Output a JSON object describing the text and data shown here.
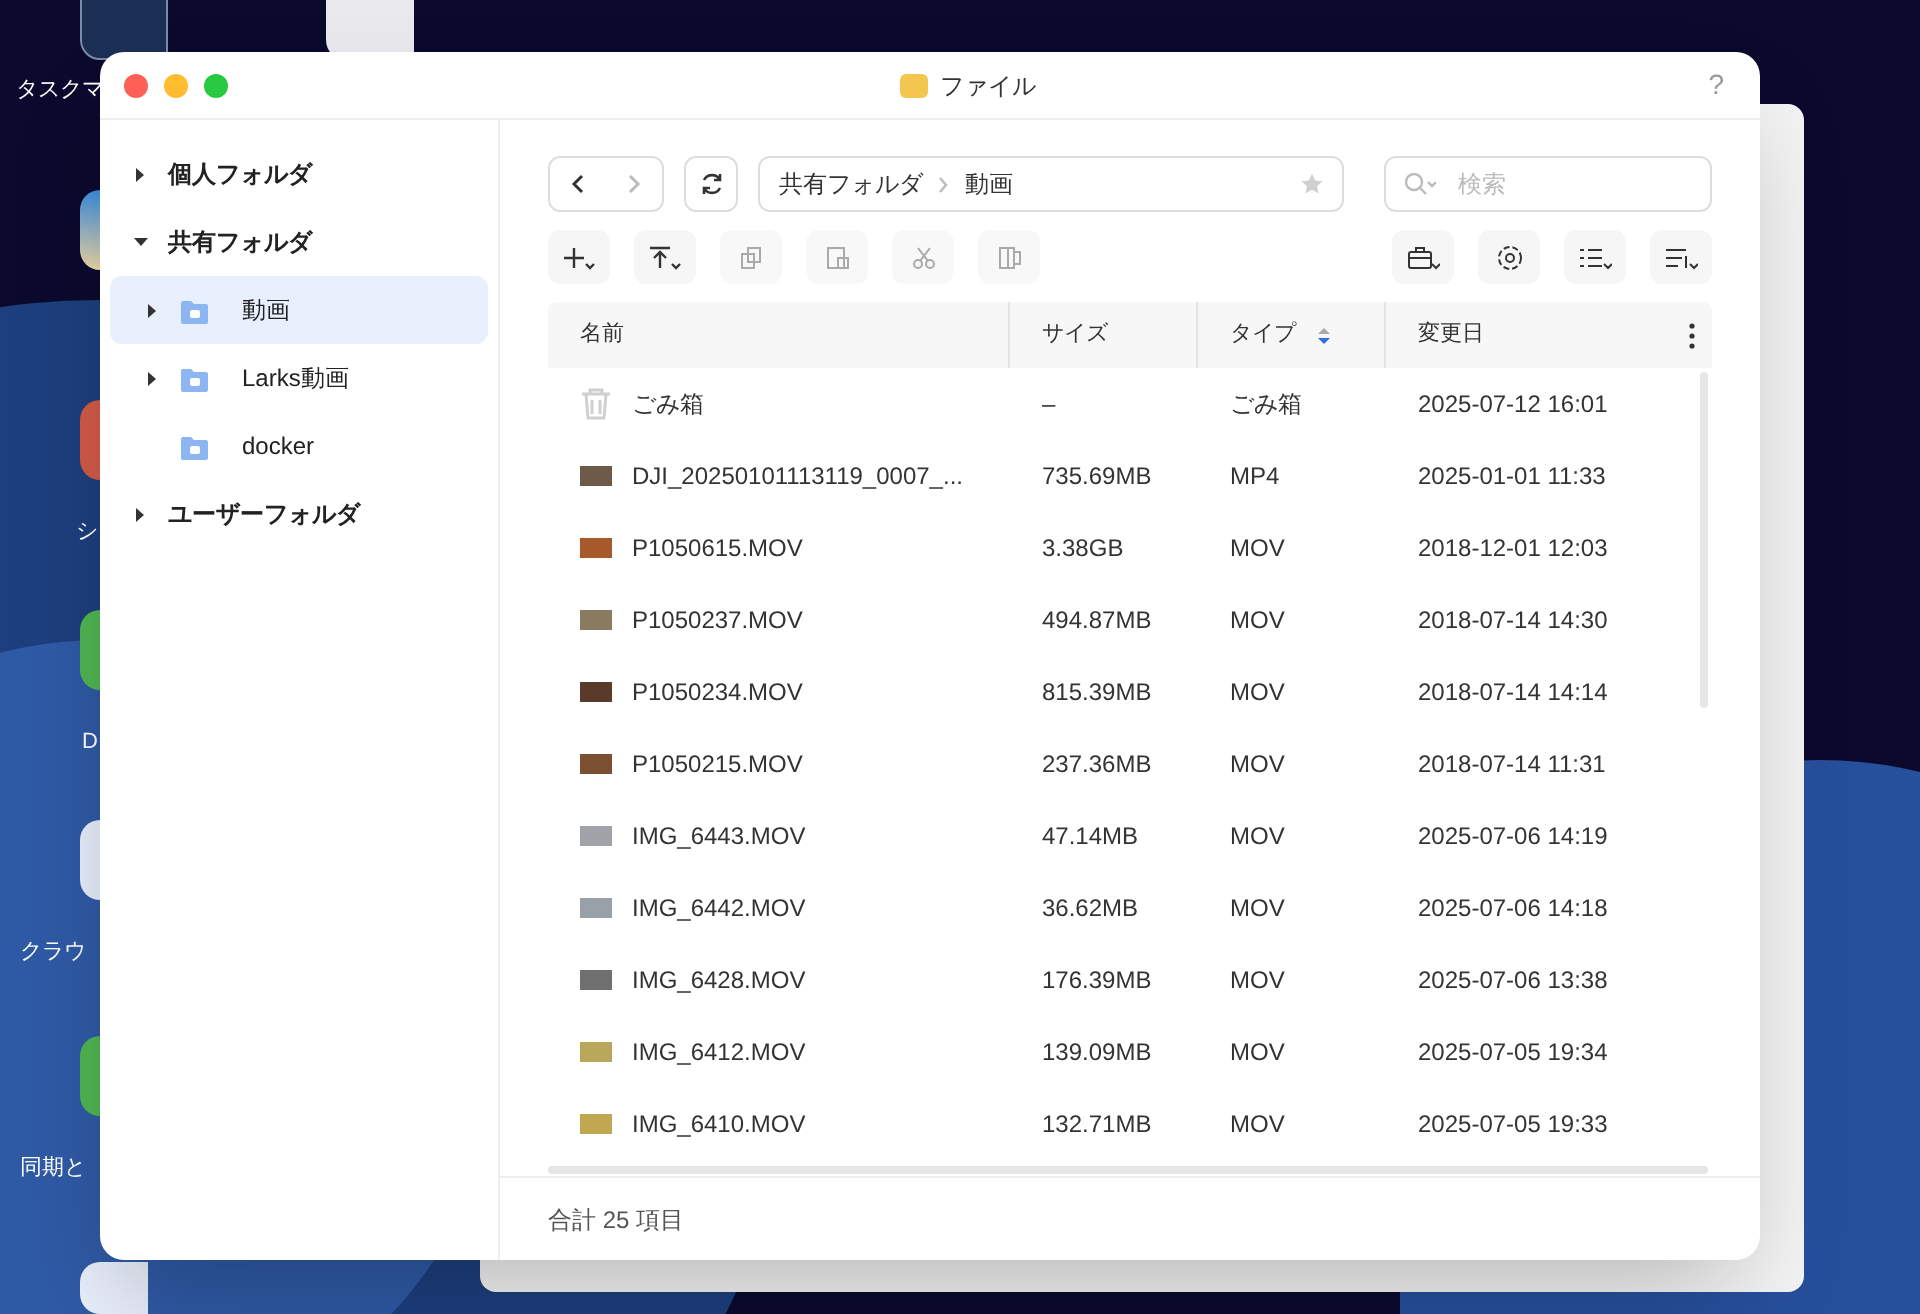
{
  "desktop": {
    "icons": [
      {
        "kind": "monitor",
        "label": "タスクマ"
      },
      {
        "kind": "browser"
      },
      {
        "kind": "photo"
      },
      {
        "kind": "red",
        "label": "シ"
      },
      {
        "kind": "green",
        "label": "D"
      },
      {
        "kind": "blue",
        "label": "クラウ"
      },
      {
        "kind": "green",
        "label": "同期と"
      },
      {
        "kind": "docker"
      }
    ]
  },
  "window": {
    "title": "ファイル",
    "help": "?"
  },
  "sidebar": {
    "items": [
      {
        "label": "個人フォルダ",
        "expanded": false,
        "selected": false
      },
      {
        "label": "共有フォルダ",
        "expanded": true,
        "selected": false,
        "children": [
          {
            "label": "動画",
            "has_children": true,
            "selected": true
          },
          {
            "label": "Larks動画",
            "has_children": true,
            "selected": false
          },
          {
            "label": "docker",
            "has_children": false,
            "selected": false
          }
        ]
      },
      {
        "label": "ユーザーフォルダ",
        "expanded": false,
        "selected": false
      }
    ]
  },
  "path_bar": {
    "breadcrumb": [
      "共有フォルダ",
      "動画"
    ],
    "favorite": false
  },
  "search": {
    "placeholder": "検索"
  },
  "table": {
    "columns": [
      {
        "label": "名前",
        "sorted": false
      },
      {
        "label": "サイズ",
        "sorted": false
      },
      {
        "label": "タイプ",
        "sorted": true
      },
      {
        "label": "変更日",
        "sorted": false
      }
    ],
    "rows": [
      {
        "kind": "trash",
        "name": "ごみ箱",
        "size": "–",
        "type": "ごみ箱",
        "modified": "2025-07-12 16:01"
      },
      {
        "kind": "video",
        "name": "DJI_20250101113119_0007_...",
        "size": "735.69MB",
        "type": "MP4",
        "modified": "2025-01-01 11:33"
      },
      {
        "kind": "video",
        "name": "P1050615.MOV",
        "size": "3.38GB",
        "type": "MOV",
        "modified": "2018-12-01 12:03"
      },
      {
        "kind": "video",
        "name": "P1050237.MOV",
        "size": "494.87MB",
        "type": "MOV",
        "modified": "2018-07-14 14:30"
      },
      {
        "kind": "video",
        "name": "P1050234.MOV",
        "size": "815.39MB",
        "type": "MOV",
        "modified": "2018-07-14 14:14"
      },
      {
        "kind": "video",
        "name": "P1050215.MOV",
        "size": "237.36MB",
        "type": "MOV",
        "modified": "2018-07-14 11:31"
      },
      {
        "kind": "video",
        "name": "IMG_6443.MOV",
        "size": "47.14MB",
        "type": "MOV",
        "modified": "2025-07-06 14:19"
      },
      {
        "kind": "video",
        "name": "IMG_6442.MOV",
        "size": "36.62MB",
        "type": "MOV",
        "modified": "2025-07-06 14:18"
      },
      {
        "kind": "video",
        "name": "IMG_6428.MOV",
        "size": "176.39MB",
        "type": "MOV",
        "modified": "2025-07-06 13:38"
      },
      {
        "kind": "video",
        "name": "IMG_6412.MOV",
        "size": "139.09MB",
        "type": "MOV",
        "modified": "2025-07-05 19:34"
      },
      {
        "kind": "video",
        "name": "IMG_6410.MOV",
        "size": "132.71MB",
        "type": "MOV",
        "modified": "2025-07-05 19:33"
      }
    ]
  },
  "status_bar": {
    "summary": "合計 25 項目"
  }
}
